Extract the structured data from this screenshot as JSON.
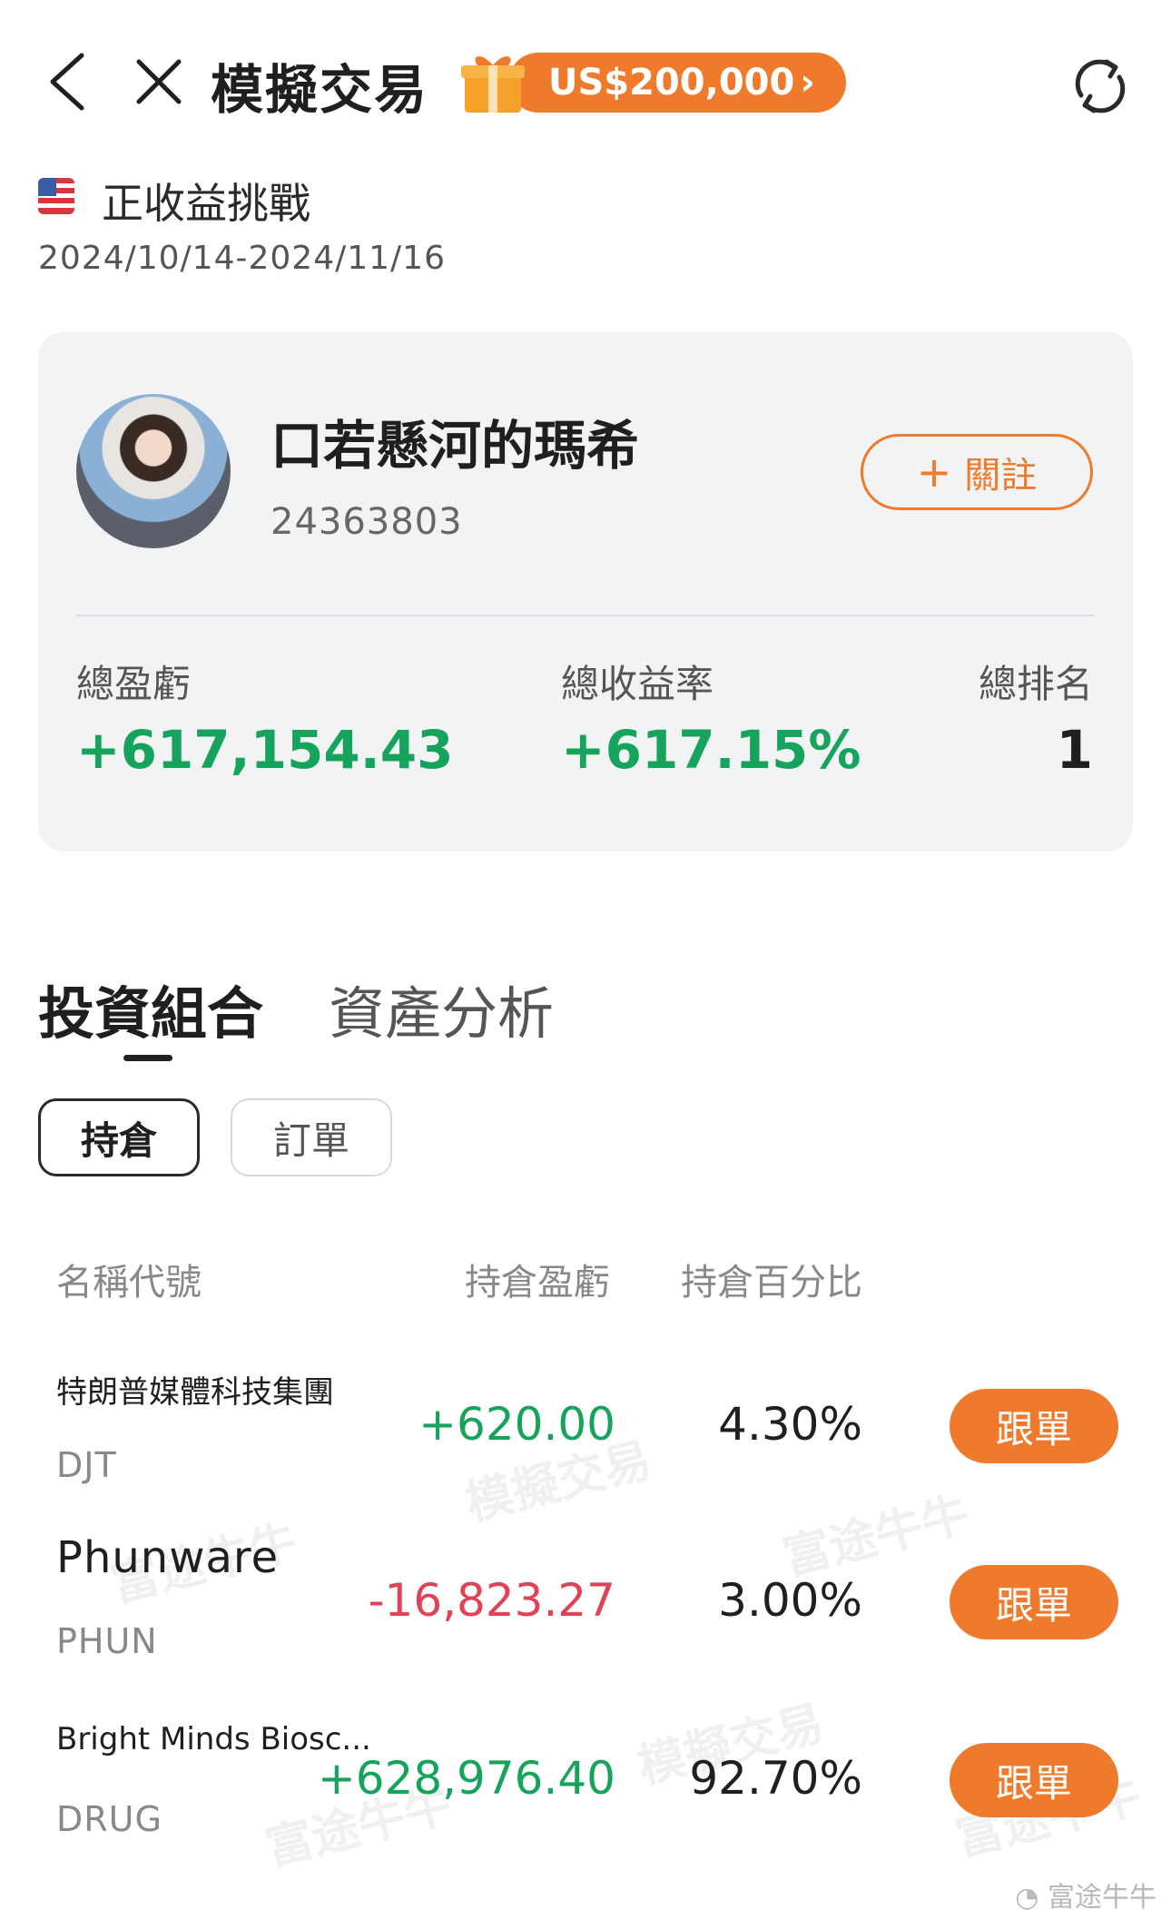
{
  "header": {
    "title": "模擬交易",
    "gift_amount": "US$200,000",
    "gift_chevron": "›",
    "icons": {
      "back": "back-arrow-icon",
      "close": "close-icon",
      "gift": "gift-icon",
      "refresh": "refresh-icon"
    }
  },
  "challenge": {
    "flag": "us-flag-icon",
    "name": "正收益挑戰",
    "dates": "2024/10/14-2024/11/16"
  },
  "profile": {
    "username": "口若懸河的瑪希",
    "user_id": "24363803",
    "follow_label": "關註",
    "follow_plus": "+"
  },
  "stats": {
    "total_pnl_label": "總盈虧",
    "total_pnl_value": "+617,154.43",
    "total_return_label": "總收益率",
    "total_return_value": "+617.15%",
    "total_rank_label": "總排名",
    "total_rank_value": "1"
  },
  "tabs": {
    "portfolio": "投資組合",
    "analysis": "資產分析"
  },
  "subtabs": {
    "positions": "持倉",
    "orders": "訂單"
  },
  "table": {
    "headers": {
      "name": "名稱代號",
      "pnl": "持倉盈虧",
      "pct": "持倉百分比"
    },
    "rows": [
      {
        "name": "特朗普媒體科技集團",
        "code": "DJT",
        "pnl": "+620.00",
        "pct": "4.30%",
        "action": "跟單"
      },
      {
        "name": "Phunware",
        "code": "PHUN",
        "pnl": "-16,823.27",
        "pct": "3.00%",
        "action": "跟單"
      },
      {
        "name": "Bright Minds Biosc...",
        "code": "DRUG",
        "pnl": "+628,976.40",
        "pct": "92.70%",
        "action": "跟單"
      }
    ]
  },
  "watermark": {
    "brand": "富途牛牛",
    "mock": "模擬交易"
  },
  "colors": {
    "accent": "#f07a2c",
    "gain": "#16a35c",
    "loss": "#e04356"
  }
}
